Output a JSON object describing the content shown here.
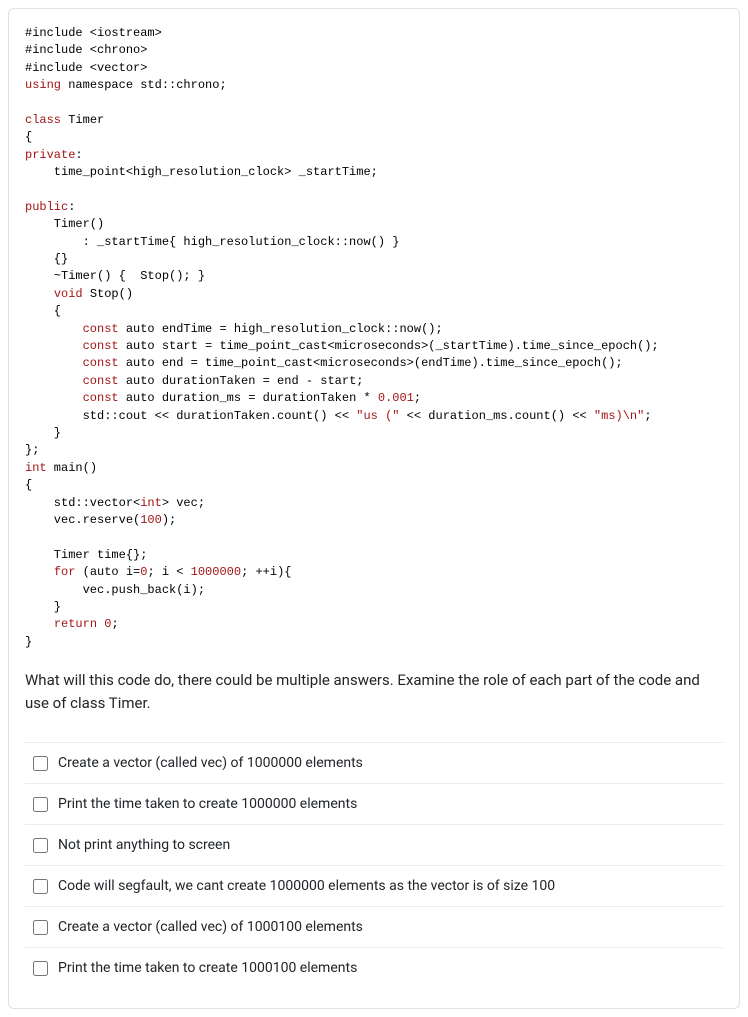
{
  "code": {
    "l01": "#include <iostream>",
    "l02": "#include <chrono>",
    "l03": "#include <vector>",
    "l04a": "using",
    "l04b": " namespace std::chrono;",
    "l05": "",
    "l06a": "class",
    "l06b": " Timer",
    "l07": "{",
    "l08a": "private",
    "l08b": ":",
    "l09": "    time_point<high_resolution_clock> _startTime;",
    "l10": "",
    "l11a": "public",
    "l11b": ":",
    "l12": "    Timer()",
    "l13": "        : _startTime{ high_resolution_clock::now() }",
    "l14": "    {}",
    "l15": "    ~Timer() {  Stop(); }",
    "l16a": "    ",
    "l16b": "void",
    "l16c": " Stop()",
    "l17": "    {",
    "l18a": "        ",
    "l18b": "const",
    "l18c": " auto endTime = high_resolution_clock::now();",
    "l19a": "        ",
    "l19b": "const",
    "l19c": " auto start = time_point_cast<microseconds>(_startTime).time_since_epoch();",
    "l20a": "        ",
    "l20b": "const",
    "l20c": " auto end = time_point_cast<microseconds>(endTime).time_since_epoch();",
    "l21a": "        ",
    "l21b": "const",
    "l21c": " auto durationTaken = end - start;",
    "l22a": "        ",
    "l22b": "const",
    "l22c": " auto duration_ms = durationTaken * ",
    "l22d": "0.001",
    "l22e": ";",
    "l23a": "        std::cout << durationTaken.count() << ",
    "l23b": "\"us (\"",
    "l23c": " << duration_ms.count() << ",
    "l23d": "\"ms)\\n\"",
    "l23e": ";",
    "l24": "    }",
    "l25": "};",
    "l26a": "int",
    "l26b": " main()",
    "l27": "{",
    "l28a": "    std::vector<",
    "l28b": "int",
    "l28c": "> vec;",
    "l29a": "    vec.reserve(",
    "l29b": "100",
    "l29c": ");",
    "l30": "",
    "l31": "    Timer time{};",
    "l32a": "    ",
    "l32b": "for",
    "l32c": " (auto i=",
    "l32d": "0",
    "l32e": "; i < ",
    "l32f": "1000000",
    "l32g": "; ++i){",
    "l33": "        vec.push_back(i);",
    "l34": "    }",
    "l35a": "    ",
    "l35b": "return",
    "l35c": " ",
    "l35d": "0",
    "l35e": ";",
    "l36": "}"
  },
  "question": "What will this code do, there could be multiple answers. Examine the role of each part of the code and use of class Timer.",
  "options": [
    "Create a vector (called vec) of 1000000 elements",
    "Print the time taken to create 1000000 elements",
    "Not print anything to screen",
    "Code will segfault, we cant create 1000000 elements as the vector is of size 100",
    "Create a vector (called vec) of 1000100 elements",
    "Print the time taken to create 1000100 elements"
  ]
}
